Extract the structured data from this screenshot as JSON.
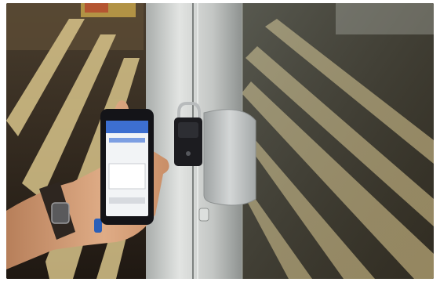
{
  "scene": {
    "colors": {
      "floor_dark": "#2c2218",
      "floor_stripe": "#d8c48a",
      "glass_tint": "#8a8f86",
      "door_frame": "#c9ccc9",
      "lock_body": "#1c1c20",
      "handle_plate": "#b9bcbc",
      "skin": "#d9a27a",
      "phone_body": "#141418",
      "phone_screen_header": "#3d6fd0",
      "phone_screen_bg": "#f2f4f6",
      "watch_strap": "#2e2620"
    },
    "icons": {
      "lock": "padlock-icon",
      "phone": "smartphone-icon"
    }
  }
}
